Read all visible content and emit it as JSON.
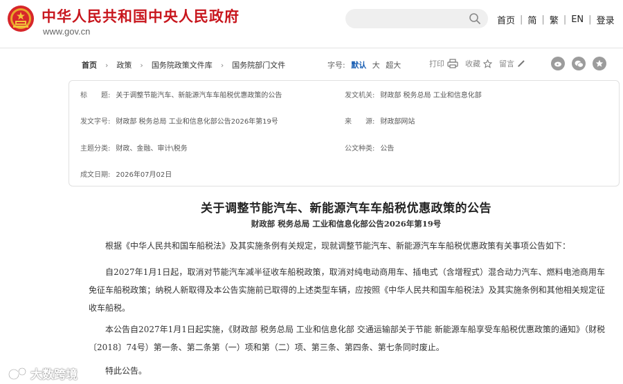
{
  "header": {
    "site_title": "中华人民共和国中央人民政府",
    "site_url": "www.gov.cn",
    "search_placeholder": "",
    "nav": [
      "首页",
      "简",
      "繁",
      "EN",
      "登录"
    ],
    "emblem_color": "#c8161d"
  },
  "breadcrumb": [
    "首页",
    "政策",
    "国务院政策文件库",
    "国务院部门文件"
  ],
  "font_size": {
    "label": "字号:",
    "options": [
      "默认",
      "大",
      "超大"
    ],
    "selected": "默认"
  },
  "tools": {
    "print": "打印",
    "favorite": "收藏",
    "comment": "留言"
  },
  "share_icons": [
    "weibo-icon",
    "wechat-icon",
    "qzone-icon"
  ],
  "meta": {
    "title_label": "标　　题:",
    "title_value": "关于调整节能汽车、新能源汽车车船税优惠政策的公告",
    "issuer_label": "发文机关:",
    "issuer_value": "财政部  税务总局  工业和信息化部",
    "docno_label": "发文字号:",
    "docno_value": "财政部 税务总局 工业和信息化部公告2026年第19号",
    "source_label": "来　　源:",
    "source_value": "财政部网站",
    "category_label": "主题分类:",
    "category_value": "财政、金融、审计\\税务",
    "doctype_label": "公文种类:",
    "doctype_value": "公告",
    "date_label": "成文日期:",
    "date_value": "2026年07月02日"
  },
  "article": {
    "title": "关于调整节能汽车、新能源汽车车船税优惠政策的公告",
    "doc_number": "财政部  税务总局  工业和信息化部公告2026年第19号",
    "paragraphs": [
      "根据《中华人民共和国车船税法》及其实施条例有关规定，现就调整节能汽车、新能源汽车车船税优惠政策有关事项公告如下：",
      "自2027年1月1日起，取消对节能汽车减半征收车船税政策，取消对纯电动商用车、插电式（含增程式）混合动力汽车、燃料电池商用车免征车船税政策；纳税人新取得及本公告实施前已取得的上述类型车辆，应按照《中华人民共和国车船税法》及其实施条例和其他相关规定征收车船税。",
      "本公告自2027年1月1日起实施，《财政部  税务总局  工业和信息化部  交通运输部关于节能  新能源车船享受车船税优惠政策的通知》（财税〔2018〕74号）第一条、第二条第（一）项和第（二）项、第三条、第四条、第七条同时废止。",
      "特此公告。"
    ]
  },
  "watermark": {
    "text": "大数跨境"
  }
}
